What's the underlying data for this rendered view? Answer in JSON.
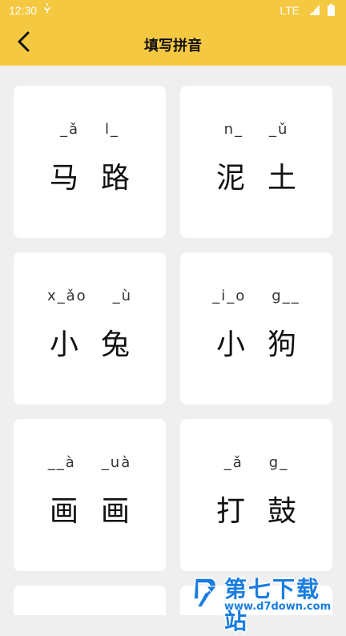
{
  "status_bar": {
    "time": "12:30",
    "network": "LTE"
  },
  "header": {
    "title": "填写拼音",
    "back_icon": "chevron-left-icon"
  },
  "cards": [
    {
      "pinyin": [
        "_ǎ",
        "l_"
      ],
      "hanzi": [
        "马",
        "路"
      ]
    },
    {
      "pinyin": [
        "n_",
        "_ǔ"
      ],
      "hanzi": [
        "泥",
        "土"
      ]
    },
    {
      "pinyin": [
        "x_ǎo",
        "_ù"
      ],
      "hanzi": [
        "小",
        "兔"
      ]
    },
    {
      "pinyin": [
        "_i_o",
        "g__"
      ],
      "hanzi": [
        "小",
        "狗"
      ]
    },
    {
      "pinyin": [
        "__à",
        "_uà"
      ],
      "hanzi": [
        "画",
        "画"
      ]
    },
    {
      "pinyin": [
        "_ǎ",
        "g_"
      ],
      "hanzi": [
        "打",
        "鼓"
      ]
    }
  ],
  "watermark": {
    "title": "第七下载站",
    "url": "www.d7down.com"
  },
  "colors": {
    "header": "#f5c842",
    "background": "#efefef",
    "card": "#ffffff",
    "watermark": "#1a7de0"
  }
}
